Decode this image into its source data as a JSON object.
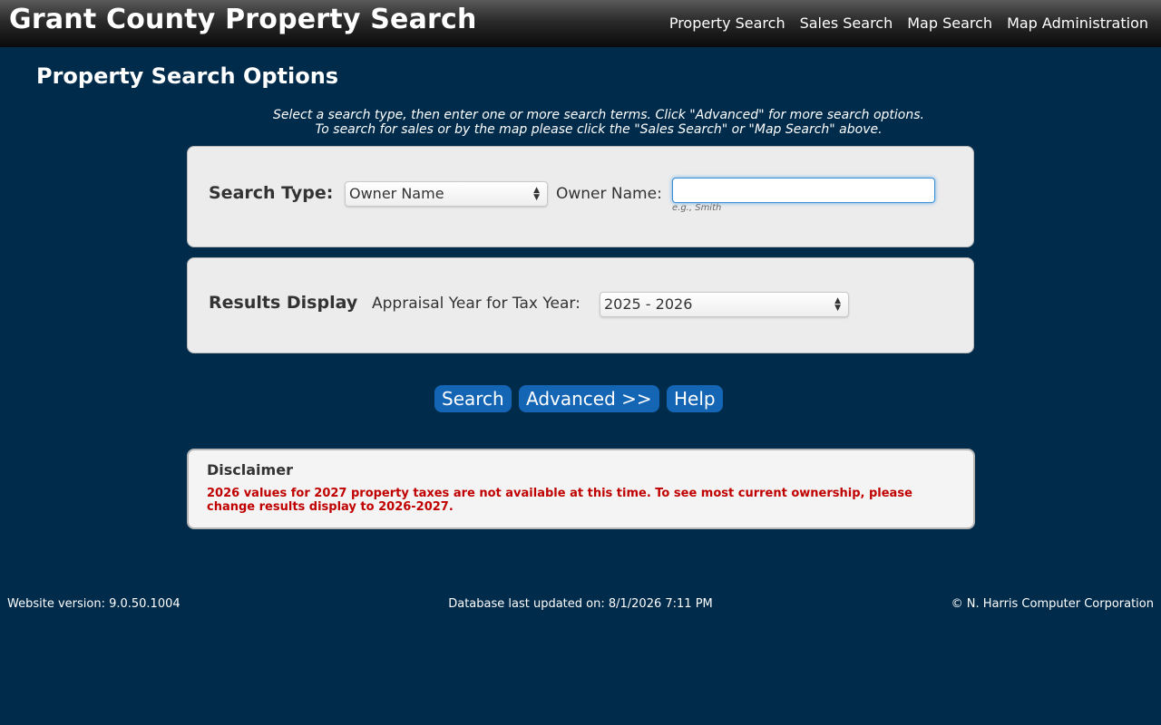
{
  "header": {
    "title": "Grant County Property Search",
    "nav": [
      "Property Search",
      "Sales Search",
      "Map Search",
      "Map Administration"
    ]
  },
  "page": {
    "title": "Property Search Options",
    "instructions": [
      "Select a search type, then enter one or more search terms. Click \"Advanced\" for more search options.",
      "To search for sales or by the map please click the \"Sales Search\" or \"Map Search\" above."
    ]
  },
  "search_panel": {
    "type_label": "Search Type:",
    "type_value": "Owner Name",
    "field_label": "Owner Name:",
    "field_value": "",
    "field_hint": "e.g., Smith"
  },
  "results_panel": {
    "heading": "Results Display",
    "year_label": "Appraisal Year for Tax Year:",
    "year_value": "2025 - 2026"
  },
  "buttons": {
    "search": "Search",
    "advanced": "Advanced >>",
    "help": "Help"
  },
  "disclaimer": {
    "title": "Disclaimer",
    "text": "2026 values for 2027 property taxes are not available at this time. To see most current ownership, please change results display to 2026-2027."
  },
  "footer": {
    "version": "Website version: 9.0.50.1004",
    "db_updated": "Database last updated on: 8/1/2026 7:11 PM",
    "copyright": "© N. Harris Computer Corporation"
  },
  "colors": {
    "background": "#002b4b",
    "button": "#1565b5",
    "disclaimer_text": "#c00000"
  },
  "icons": {
    "select_arrow": "updown-arrows-icon"
  }
}
